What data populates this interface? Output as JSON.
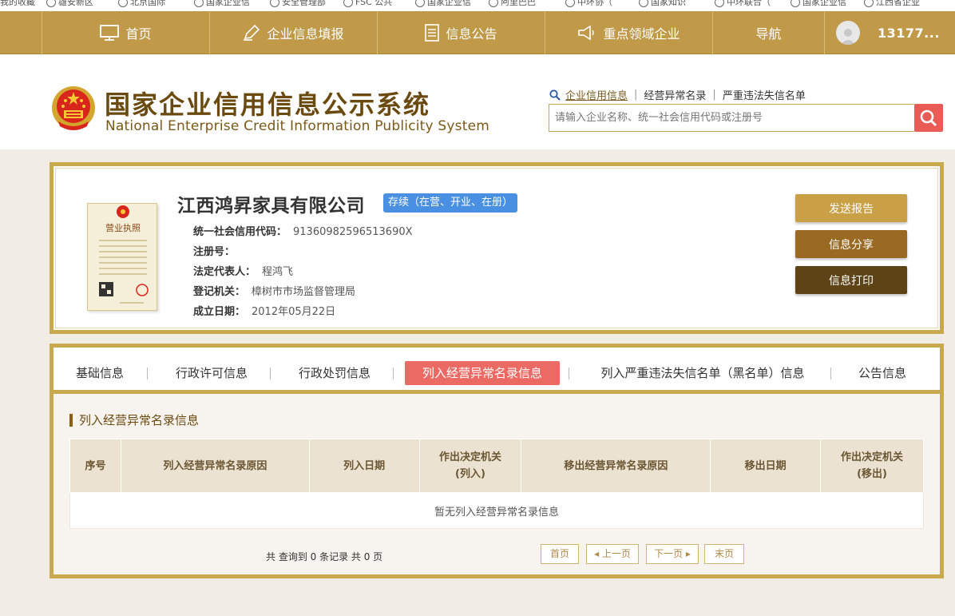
{
  "bookmarks": [
    {
      "label": "我的收藏"
    },
    {
      "label": "雄安新区"
    },
    {
      "label": "北京国际"
    },
    {
      "label": "国家企业信"
    },
    {
      "label": "安全管理部"
    },
    {
      "label": "FSC 公共"
    },
    {
      "label": "国家企业信"
    },
    {
      "label": "阿里巴巴"
    },
    {
      "label": "中环协（"
    },
    {
      "label": "国家知识"
    },
    {
      "label": "中环联合（"
    },
    {
      "label": "国家企业信"
    },
    {
      "label": "江西省企业"
    }
  ],
  "nav": {
    "home": "首页",
    "report": "企业信息填报",
    "notice": "信息公告",
    "key_field": "重点领域企业",
    "guide": "导航",
    "user": "13177..."
  },
  "header": {
    "title": "国家企业信用信息公示系统",
    "subtitle": "National Enterprise Credit Information Publicity System",
    "search_tabs": [
      "企业信用信息",
      "经营异常名录",
      "严重违法失信名单"
    ],
    "search_placeholder": "请输入企业名称、统一社会信用代码或注册号"
  },
  "company": {
    "name": "江西鸿昇家具有限公司",
    "status": "存续（在营、开业、在册）",
    "credit_code_label": "统一社会信用代码：",
    "credit_code": "91360982596513690X",
    "reg_no_label": "注册号：",
    "reg_no": "",
    "legal_rep_label": "法定代表人：",
    "legal_rep": "程鸿飞",
    "authority_label": "登记机关：",
    "authority": "樟树市市场监督管理局",
    "date_label": "成立日期：",
    "date": "2012年05月22日",
    "license_title": "营业执照"
  },
  "actions": {
    "send": "发送报告",
    "share": "信息分享",
    "print": "信息打印"
  },
  "tabs": [
    "基础信息",
    "行政许可信息",
    "行政处罚信息",
    "列入经营异常名录信息",
    "列入严重违法失信名单（黑名单）信息",
    "公告信息"
  ],
  "section": {
    "title": "列入经营异常名录信息",
    "columns": [
      "序号",
      "列入经营异常名录原因",
      "列入日期",
      "作出决定机关\n(列入)",
      "移出经营异常名录原因",
      "移出日期",
      "作出决定机关\n(移出)"
    ],
    "empty": "暂无列入经营异常名录信息"
  },
  "pagination": {
    "summary": "共 查询到 0 条记录 共 0 页",
    "first": "首页",
    "prev": "上一页",
    "next": "下一页",
    "last": "末页"
  },
  "colors": {
    "nav_bg": "#c09a48",
    "gold_border": "#c9a94e",
    "title_brown": "#6b4a10",
    "active_tab": "#ec6a64",
    "status_blue": "#4a90e2",
    "search_red": "#e95b55",
    "btn_send": "#c9a046",
    "btn_share": "#9a6a22",
    "btn_print": "#5e4317"
  }
}
